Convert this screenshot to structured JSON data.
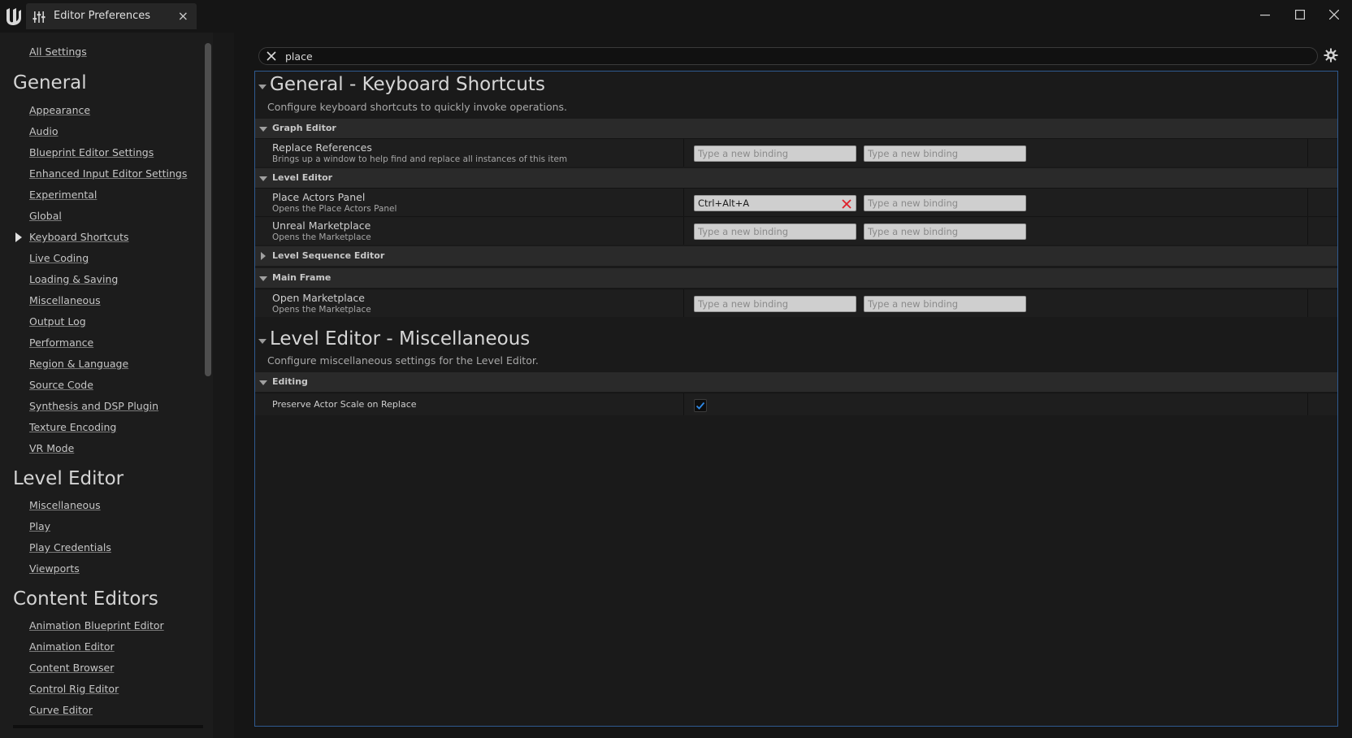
{
  "window": {
    "tab_title": "Editor Preferences",
    "close_glyph": "×"
  },
  "sidebar": {
    "all_settings": "All Settings",
    "categories": [
      {
        "title": "General",
        "items": [
          "Appearance",
          "Audio",
          "Blueprint Editor Settings",
          "Enhanced Input Editor Settings",
          "Experimental",
          "Global",
          "Keyboard Shortcuts",
          "Live Coding",
          "Loading & Saving",
          "Miscellaneous",
          "Output Log",
          "Performance",
          "Region & Language",
          "Source Code",
          "Synthesis and DSP Plugin",
          "Texture Encoding",
          "VR Mode"
        ]
      },
      {
        "title": "Level Editor",
        "items": [
          "Miscellaneous",
          "Play",
          "Play Credentials",
          "Viewports"
        ]
      },
      {
        "title": "Content Editors",
        "items": [
          "Animation Blueprint Editor",
          "Animation Editor",
          "Content Browser",
          "Control Rig Editor",
          "Curve Editor"
        ]
      }
    ],
    "selected_item": "Keyboard Shortcuts"
  },
  "search": {
    "value": "place"
  },
  "sections": {
    "shortcuts": {
      "title": "General - Keyboard Shortcuts",
      "description": "Configure keyboard shortcuts to quickly invoke operations.",
      "groups": {
        "graph_editor": "Graph Editor",
        "level_editor": "Level Editor",
        "level_sequence_editor": "Level Sequence Editor",
        "main_frame": "Main Frame"
      },
      "rows": {
        "replace_references": {
          "name": "Replace References",
          "desc": "Brings up a window to help find and replace all instances of this item"
        },
        "place_actors": {
          "name": "Place Actors Panel",
          "desc": "Opens the Place Actors Panel",
          "binding1": "Ctrl+Alt+A"
        },
        "unreal_marketplace": {
          "name": "Unreal Marketplace",
          "desc": "Opens the Marketplace"
        },
        "open_marketplace": {
          "name": "Open Marketplace",
          "desc": "Opens the Marketplace"
        }
      },
      "binding_placeholder": "Type a new binding"
    },
    "misc": {
      "title": "Level Editor - Miscellaneous",
      "description": "Configure miscellaneous settings for the Level Editor.",
      "group": "Editing",
      "row": {
        "name": "Preserve Actor Scale on Replace",
        "checked": true
      }
    }
  },
  "colors": {
    "accent": "#2f5a8f",
    "checkmark": "#2f8ae8",
    "clear_x": "#e0202a"
  }
}
